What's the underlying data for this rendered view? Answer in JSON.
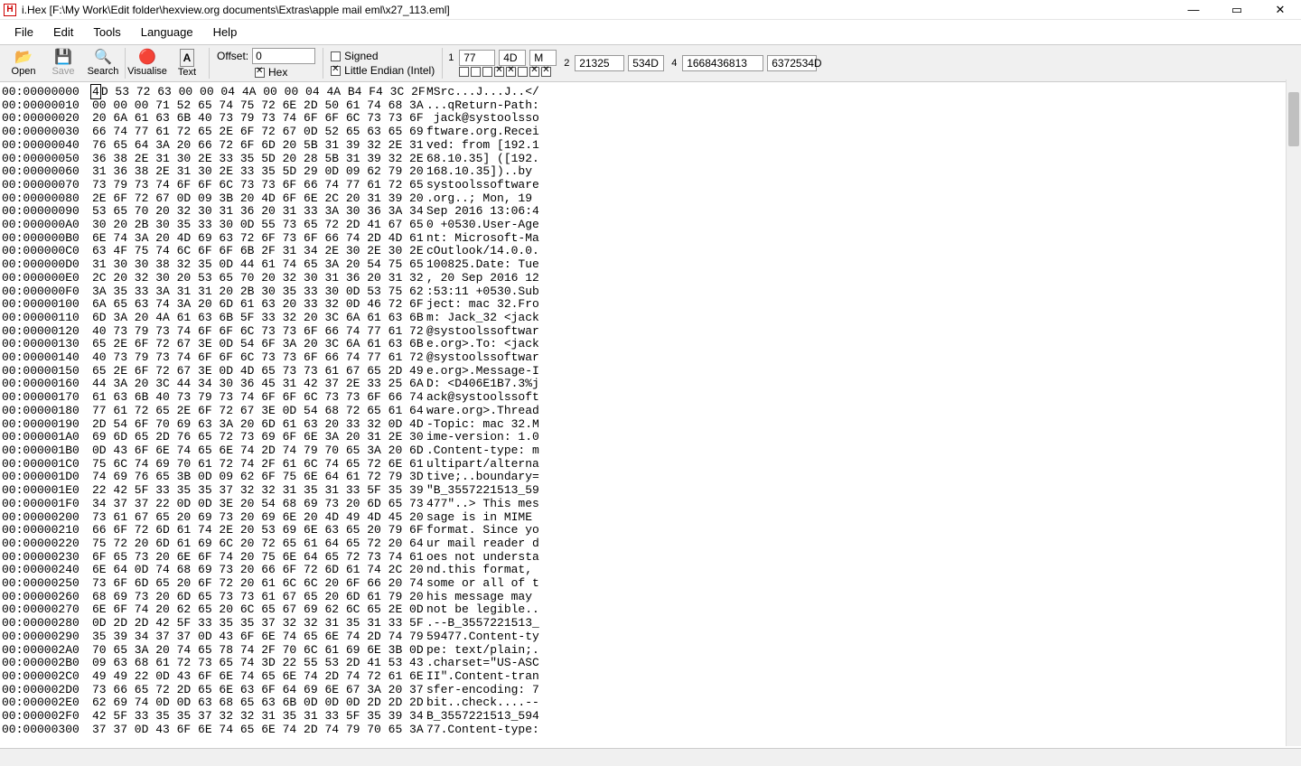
{
  "window": {
    "title": "i.Hex [F:\\My Work\\Edit folder\\hexview.org documents\\Extras\\apple mail eml\\x27_113.eml]",
    "app_icon_letter": "H"
  },
  "menu": {
    "file": "File",
    "edit": "Edit",
    "tools": "Tools",
    "language": "Language",
    "help": "Help"
  },
  "tools": {
    "open": "Open",
    "save": "Save",
    "search": "Search",
    "visualise": "Visualise",
    "text": "Text"
  },
  "offset": {
    "label": "Offset:",
    "value": "0",
    "hex_label": "Hex"
  },
  "flags": {
    "signed": "Signed",
    "endian": "Little Endian (Intel)"
  },
  "vals": {
    "r1": {
      "idx": "1",
      "a": "77",
      "b": "4D",
      "c": "M"
    },
    "r2": {
      "idx": "2",
      "a": "21325",
      "b": "534D"
    },
    "r4": {
      "idx": "4",
      "a": "1668436813",
      "b": "6372534D"
    }
  },
  "rows": [
    {
      "a": "00:00000000",
      "h": "4D 53 72 63 00 00 04 4A 00 00 04 4A B4 F4 3C 2F",
      "t": "MSrc...J...J..</"
    },
    {
      "a": "00:00000010",
      "h": "00 00 00 71 52 65 74 75 72 6E 2D 50 61 74 68 3A",
      "t": "...qReturn-Path:"
    },
    {
      "a": "00:00000020",
      "h": "20 6A 61 63 6B 40 73 79 73 74 6F 6F 6C 73 73 6F",
      "t": " jack@systoolsso"
    },
    {
      "a": "00:00000030",
      "h": "66 74 77 61 72 65 2E 6F 72 67 0D 52 65 63 65 69",
      "t": "ftware.org.Recei"
    },
    {
      "a": "00:00000040",
      "h": "76 65 64 3A 20 66 72 6F 6D 20 5B 31 39 32 2E 31",
      "t": "ved: from [192.1"
    },
    {
      "a": "00:00000050",
      "h": "36 38 2E 31 30 2E 33 35 5D 20 28 5B 31 39 32 2E",
      "t": "68.10.35] ([192."
    },
    {
      "a": "00:00000060",
      "h": "31 36 38 2E 31 30 2E 33 35 5D 29 0D 09 62 79 20",
      "t": "168.10.35])..by "
    },
    {
      "a": "00:00000070",
      "h": "73 79 73 74 6F 6F 6C 73 73 6F 66 74 77 61 72 65",
      "t": "systoolssoftware"
    },
    {
      "a": "00:00000080",
      "h": "2E 6F 72 67 0D 09 3B 20 4D 6F 6E 2C 20 31 39 20",
      "t": ".org..; Mon, 19 "
    },
    {
      "a": "00:00000090",
      "h": "53 65 70 20 32 30 31 36 20 31 33 3A 30 36 3A 34",
      "t": "Sep 2016 13:06:4"
    },
    {
      "a": "00:000000A0",
      "h": "30 20 2B 30 35 33 30 0D 55 73 65 72 2D 41 67 65",
      "t": "0 +0530.User-Age"
    },
    {
      "a": "00:000000B0",
      "h": "6E 74 3A 20 4D 69 63 72 6F 73 6F 66 74 2D 4D 61",
      "t": "nt: Microsoft-Ma"
    },
    {
      "a": "00:000000C0",
      "h": "63 4F 75 74 6C 6F 6F 6B 2F 31 34 2E 30 2E 30 2E",
      "t": "cOutlook/14.0.0."
    },
    {
      "a": "00:000000D0",
      "h": "31 30 30 38 32 35 0D 44 61 74 65 3A 20 54 75 65",
      "t": "100825.Date: Tue"
    },
    {
      "a": "00:000000E0",
      "h": "2C 20 32 30 20 53 65 70 20 32 30 31 36 20 31 32",
      "t": ", 20 Sep 2016 12"
    },
    {
      "a": "00:000000F0",
      "h": "3A 35 33 3A 31 31 20 2B 30 35 33 30 0D 53 75 62",
      "t": ":53:11 +0530.Sub"
    },
    {
      "a": "00:00000100",
      "h": "6A 65 63 74 3A 20 6D 61 63 20 33 32 0D 46 72 6F",
      "t": "ject: mac 32.Fro"
    },
    {
      "a": "00:00000110",
      "h": "6D 3A 20 4A 61 63 6B 5F 33 32 20 3C 6A 61 63 6B",
      "t": "m: Jack_32 <jack"
    },
    {
      "a": "00:00000120",
      "h": "40 73 79 73 74 6F 6F 6C 73 73 6F 66 74 77 61 72",
      "t": "@systoolssoftwar"
    },
    {
      "a": "00:00000130",
      "h": "65 2E 6F 72 67 3E 0D 54 6F 3A 20 3C 6A 61 63 6B",
      "t": "e.org>.To: <jack"
    },
    {
      "a": "00:00000140",
      "h": "40 73 79 73 74 6F 6F 6C 73 73 6F 66 74 77 61 72",
      "t": "@systoolssoftwar"
    },
    {
      "a": "00:00000150",
      "h": "65 2E 6F 72 67 3E 0D 4D 65 73 73 61 67 65 2D 49",
      "t": "e.org>.Message-I"
    },
    {
      "a": "00:00000160",
      "h": "44 3A 20 3C 44 34 30 36 45 31 42 37 2E 33 25 6A",
      "t": "D: <D406E1B7.3%j"
    },
    {
      "a": "00:00000170",
      "h": "61 63 6B 40 73 79 73 74 6F 6F 6C 73 73 6F 66 74",
      "t": "ack@systoolssoft"
    },
    {
      "a": "00:00000180",
      "h": "77 61 72 65 2E 6F 72 67 3E 0D 54 68 72 65 61 64",
      "t": "ware.org>.Thread"
    },
    {
      "a": "00:00000190",
      "h": "2D 54 6F 70 69 63 3A 20 6D 61 63 20 33 32 0D 4D",
      "t": "-Topic: mac 32.M"
    },
    {
      "a": "00:000001A0",
      "h": "69 6D 65 2D 76 65 72 73 69 6F 6E 3A 20 31 2E 30",
      "t": "ime-version: 1.0"
    },
    {
      "a": "00:000001B0",
      "h": "0D 43 6F 6E 74 65 6E 74 2D 74 79 70 65 3A 20 6D",
      "t": ".Content-type: m"
    },
    {
      "a": "00:000001C0",
      "h": "75 6C 74 69 70 61 72 74 2F 61 6C 74 65 72 6E 61",
      "t": "ultipart/alterna"
    },
    {
      "a": "00:000001D0",
      "h": "74 69 76 65 3B 0D 09 62 6F 75 6E 64 61 72 79 3D",
      "t": "tive;..boundary="
    },
    {
      "a": "00:000001E0",
      "h": "22 42 5F 33 35 35 37 32 32 31 35 31 33 5F 35 39",
      "t": "\"B_3557221513_59"
    },
    {
      "a": "00:000001F0",
      "h": "34 37 37 22 0D 0D 3E 20 54 68 69 73 20 6D 65 73",
      "t": "477\"..> This mes"
    },
    {
      "a": "00:00000200",
      "h": "73 61 67 65 20 69 73 20 69 6E 20 4D 49 4D 45 20",
      "t": "sage is in MIME "
    },
    {
      "a": "00:00000210",
      "h": "66 6F 72 6D 61 74 2E 20 53 69 6E 63 65 20 79 6F",
      "t": "format. Since yo"
    },
    {
      "a": "00:00000220",
      "h": "75 72 20 6D 61 69 6C 20 72 65 61 64 65 72 20 64",
      "t": "ur mail reader d"
    },
    {
      "a": "00:00000230",
      "h": "6F 65 73 20 6E 6F 74 20 75 6E 64 65 72 73 74 61",
      "t": "oes not understa"
    },
    {
      "a": "00:00000240",
      "h": "6E 64 0D 74 68 69 73 20 66 6F 72 6D 61 74 2C 20",
      "t": "nd.this format, "
    },
    {
      "a": "00:00000250",
      "h": "73 6F 6D 65 20 6F 72 20 61 6C 6C 20 6F 66 20 74",
      "t": "some or all of t"
    },
    {
      "a": "00:00000260",
      "h": "68 69 73 20 6D 65 73 73 61 67 65 20 6D 61 79 20",
      "t": "his message may "
    },
    {
      "a": "00:00000270",
      "h": "6E 6F 74 20 62 65 20 6C 65 67 69 62 6C 65 2E 0D",
      "t": "not be legible.."
    },
    {
      "a": "00:00000280",
      "h": "0D 2D 2D 42 5F 33 35 35 37 32 32 31 35 31 33 5F",
      "t": ".--B_3557221513_"
    },
    {
      "a": "00:00000290",
      "h": "35 39 34 37 37 0D 43 6F 6E 74 65 6E 74 2D 74 79",
      "t": "59477.Content-ty"
    },
    {
      "a": "00:000002A0",
      "h": "70 65 3A 20 74 65 78 74 2F 70 6C 61 69 6E 3B 0D",
      "t": "pe: text/plain;."
    },
    {
      "a": "00:000002B0",
      "h": "09 63 68 61 72 73 65 74 3D 22 55 53 2D 41 53 43",
      "t": ".charset=\"US-ASC"
    },
    {
      "a": "00:000002C0",
      "h": "49 49 22 0D 43 6F 6E 74 65 6E 74 2D 74 72 61 6E",
      "t": "II\".Content-tran"
    },
    {
      "a": "00:000002D0",
      "h": "73 66 65 72 2D 65 6E 63 6F 64 69 6E 67 3A 20 37",
      "t": "sfer-encoding: 7"
    },
    {
      "a": "00:000002E0",
      "h": "62 69 74 0D 0D 63 68 65 63 6B 0D 0D 0D 2D 2D 2D",
      "t": "bit..check....--"
    },
    {
      "a": "00:000002F0",
      "h": "42 5F 33 35 35 37 32 32 31 35 31 33 5F 35 39 34",
      "t": "B_3557221513_594"
    },
    {
      "a": "00:00000300",
      "h": "37 37 0D 43 6F 6E 74 65 6E 74 2D 74 79 70 65 3A",
      "t": "77.Content-type:"
    }
  ]
}
